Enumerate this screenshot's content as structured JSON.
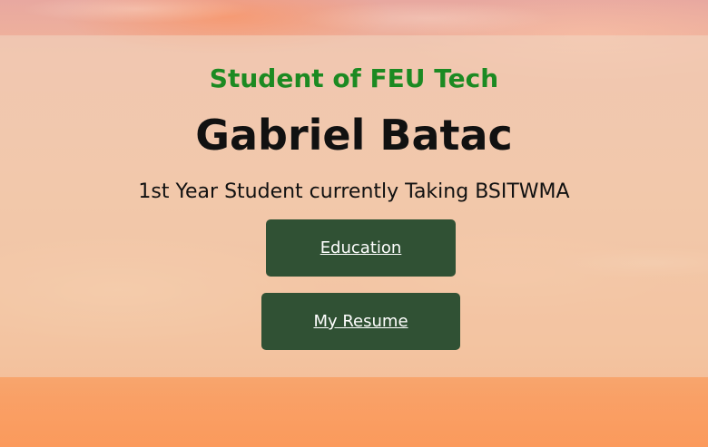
{
  "hero": {
    "subtitle": "Student of FEU Tech",
    "name": "Gabriel Batac",
    "tagline": "1st Year Student currently Taking BSITWMA"
  },
  "buttons": {
    "education_label": "Education",
    "resume_label": "My Resume"
  },
  "colors": {
    "subtitle_green": "#1c8a22",
    "button_bg": "#305134",
    "button_text": "#ffffff",
    "heading_text": "#111111"
  }
}
